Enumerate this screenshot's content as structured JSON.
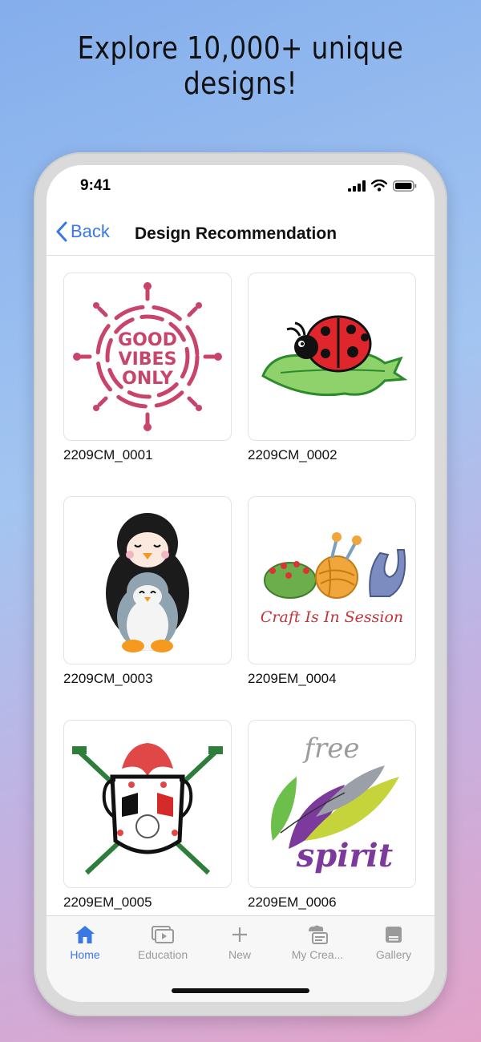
{
  "headline": "Explore 10,000+ unique designs!",
  "status": {
    "time": "9:41"
  },
  "nav": {
    "back_label": "Back",
    "title": "Design Recommendation"
  },
  "designs": [
    {
      "code": "2209CM_0001",
      "image_text": "GOOD VIBES ONLY"
    },
    {
      "code": "2209CM_0002"
    },
    {
      "code": "2209CM_0003"
    },
    {
      "code": "2209EM_0004",
      "image_text": "Craft Is In Session"
    },
    {
      "code": "2209EM_0005"
    },
    {
      "code": "2209EM_0006",
      "image_text": "free spirit"
    }
  ],
  "tabs": [
    {
      "label": "Home",
      "icon": "home-icon",
      "active": true
    },
    {
      "label": "Education",
      "icon": "video-stack-icon",
      "active": false
    },
    {
      "label": "New",
      "icon": "plus-icon",
      "active": false
    },
    {
      "label": "My Crea...",
      "icon": "my-creations-icon",
      "active": false
    },
    {
      "label": "Gallery",
      "icon": "gallery-icon",
      "active": false
    }
  ],
  "colors": {
    "accent": "#3a78e6",
    "tab_inactive": "#9a9a9a"
  }
}
